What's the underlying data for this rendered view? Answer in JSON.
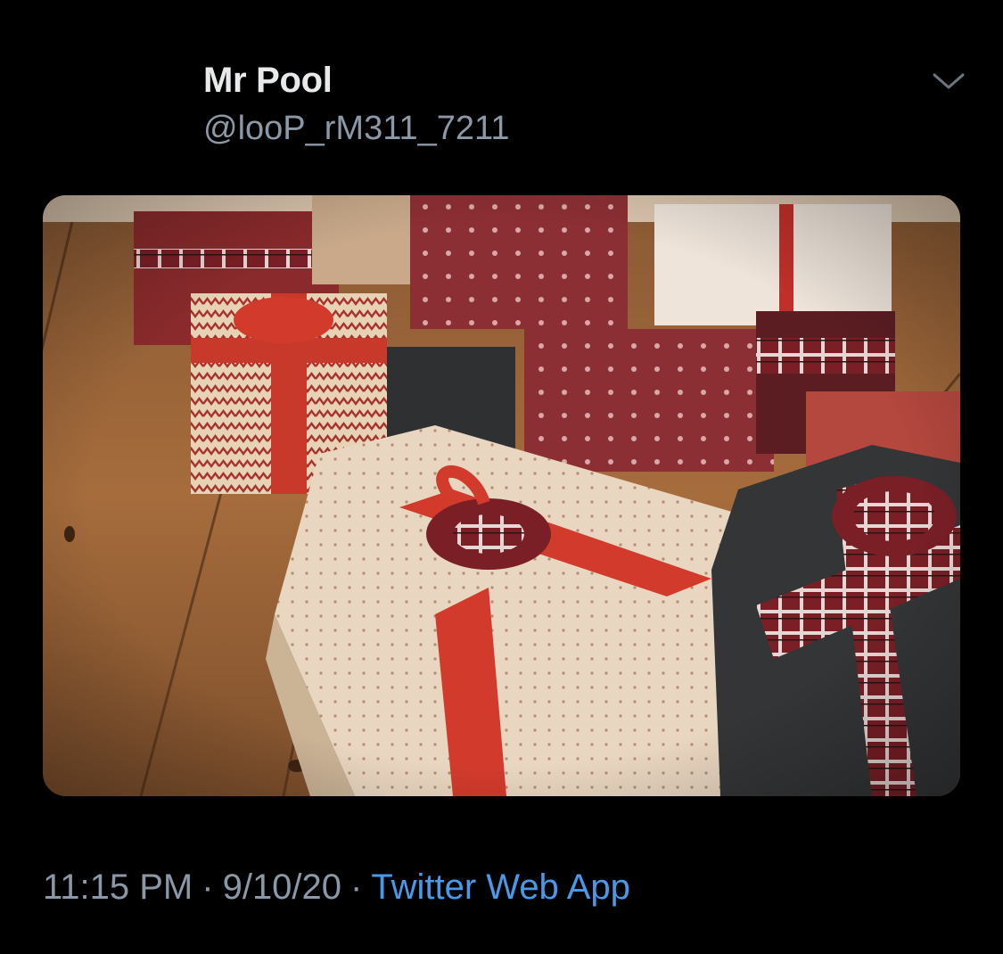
{
  "tweet": {
    "display_name": "Mr Pool",
    "handle": "@looP_rM311_7211",
    "time": "11:15 PM",
    "separator": "·",
    "date": "9/10/20",
    "source": "Twitter Web App"
  },
  "media": {
    "kind": "photo",
    "subject": "wrapped-gift-boxes"
  },
  "icons": {
    "menu": "chevron-down-icon"
  },
  "colors": {
    "background": "#000000",
    "name": "#e7e9ea",
    "secondary_text": "#8b98a5",
    "link": "#4a99e9"
  }
}
